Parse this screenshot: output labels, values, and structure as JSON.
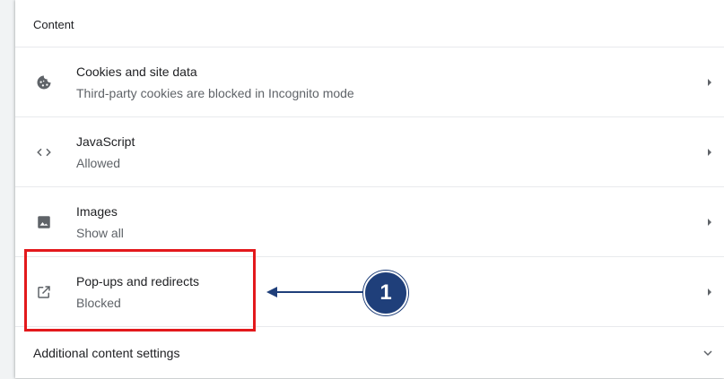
{
  "section": {
    "title": "Content"
  },
  "rows": [
    {
      "label": "Cookies and site data",
      "sub": "Third-party cookies are blocked in Incognito mode",
      "icon": "cookie-icon"
    },
    {
      "label": "JavaScript",
      "sub": "Allowed",
      "icon": "code-icon"
    },
    {
      "label": "Images",
      "sub": "Show all",
      "icon": "image-icon"
    },
    {
      "label": "Pop-ups and redirects",
      "sub": "Blocked",
      "icon": "open-in-new-icon"
    }
  ],
  "additional": {
    "label": "Additional content settings",
    "icon": "chevron-down-icon"
  },
  "annotation": {
    "number": "1",
    "highlight_color": "#e3191c",
    "badge_color": "#1f3f7a"
  }
}
